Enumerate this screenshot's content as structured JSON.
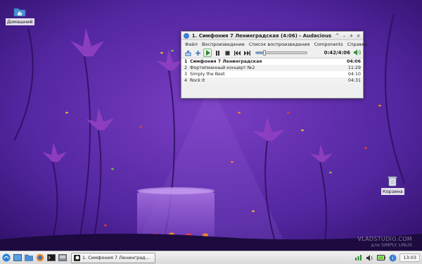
{
  "desktop": {
    "icons": [
      {
        "label": "Домашний",
        "icon": "folder-icon"
      },
      {
        "label": "Корзина",
        "icon": "trash-icon"
      }
    ],
    "watermark": {
      "line1": "VLADSTUDIO.COM",
      "line2": "для SIMPLY LINUX"
    }
  },
  "window": {
    "title": "1. Симфония 7 Ленинградская (4:06) - Audacious",
    "controls": [
      "^",
      "–",
      "+",
      "×"
    ],
    "menu": [
      "Файл",
      "Воспроизведение",
      "Список воспроизведения",
      "Components",
      "Справка"
    ],
    "toolbar": {
      "time": "0:42/4:06",
      "progress": 0.17
    },
    "playlist": [
      {
        "num": "1",
        "title": "Симфония 7 Ленинградская",
        "length": "04:06",
        "current": true
      },
      {
        "num": "2",
        "title": "Фортепианный концерт №2",
        "length": "11:29",
        "current": false
      },
      {
        "num": "3",
        "title": "Simply the Best",
        "length": "04:10",
        "current": false
      },
      {
        "num": "4",
        "title": "Rock It",
        "length": "04:31",
        "current": false
      }
    ]
  },
  "taskbar": {
    "task_label": "1. Симфония 7 Ленинград...",
    "clock": "13:03"
  },
  "colors": {
    "wallpaper": "#4a1f8c",
    "play_green": "#2d8a2d",
    "seek_fill": "#6f9fd8"
  }
}
